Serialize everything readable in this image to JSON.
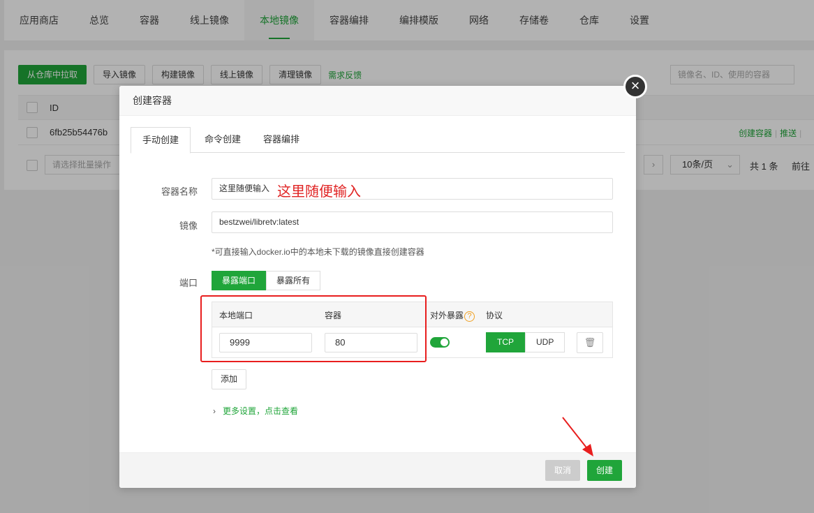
{
  "nav": [
    "应用商店",
    "总览",
    "容器",
    "线上镜像",
    "本地镜像",
    "容器编排",
    "编排模版",
    "网络",
    "存储卷",
    "仓库",
    "设置"
  ],
  "nav_active": "本地镜像",
  "toolbar": {
    "pull": "从仓库中拉取",
    "import": "导入镜像",
    "build": "构建镜像",
    "online": "线上镜像",
    "clean": "清理镜像",
    "feedback": "需求反馈"
  },
  "search_placeholder": "镜像名、ID、使用的容器",
  "table": {
    "col_id": "ID",
    "row_id": "6fb25b54476b",
    "op_create": "创建容器",
    "op_push": "推送",
    "op_sep": "|"
  },
  "footer": {
    "batch_placeholder": "请选择批量操作",
    "next": "›",
    "per_page": "10条/页",
    "per_page_caret": "⌄",
    "total": "共 1 条",
    "goto": "前往"
  },
  "modal": {
    "title": "创建容器",
    "close": "×",
    "tabs": [
      "手动创建",
      "命令创建",
      "容器编排"
    ],
    "name_label": "容器名称",
    "name_value": "这里随便输入",
    "annotation": "这里随便输入",
    "image_label": "镜像",
    "image_value": "bestzwei/libretv:latest",
    "hint": "*可直接输入docker.io中的本地未下载的镜像直接创建容器",
    "port_label": "端口",
    "port_modes": [
      "暴露端口",
      "暴露所有"
    ],
    "port_headers": {
      "local": "本地端口",
      "container": "容器",
      "expose": "对外暴露",
      "help": "?",
      "protocol": "协议"
    },
    "local_port": "9999",
    "container_port": "80",
    "protocols": [
      "TCP",
      "UDP"
    ],
    "trash_icon": "🗑",
    "add": "添加",
    "more_chevron": "›",
    "more": "更多设置，点击查看",
    "cancel": "取消",
    "create": "创建"
  },
  "colors": {
    "accent": "#20a53a",
    "annotation": "#e81e1e"
  }
}
